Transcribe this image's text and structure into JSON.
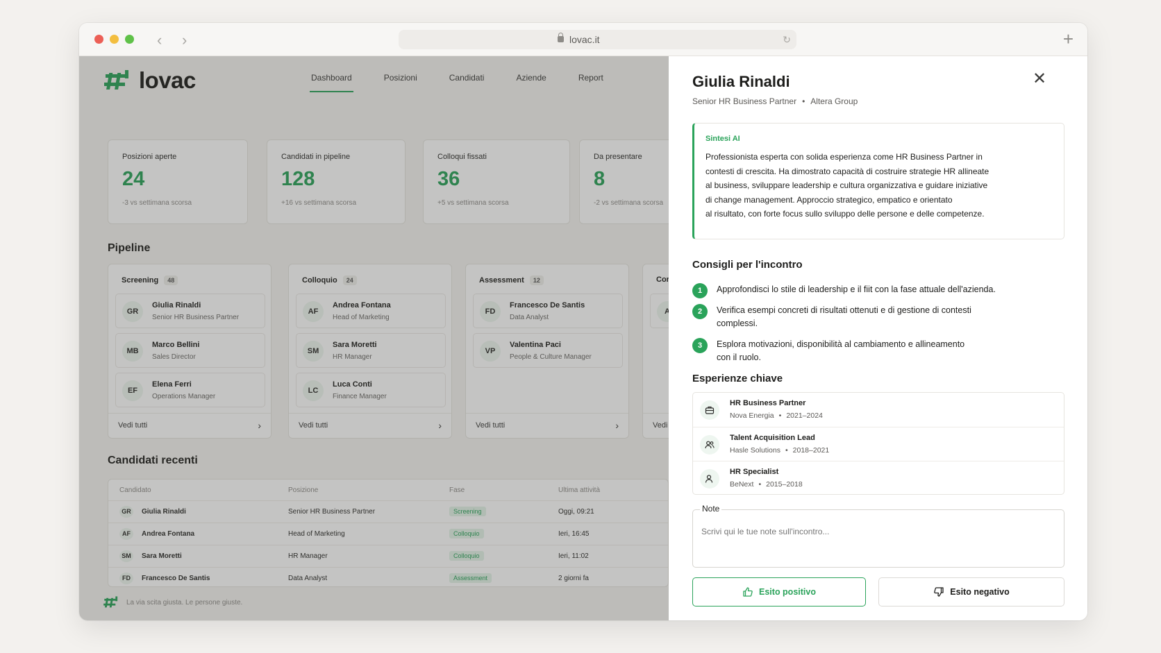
{
  "browser": {
    "url": "lovac.it"
  },
  "brand": {
    "name": "lovac",
    "tagline": "La via scita giusta. Le persone giuste.",
    "accent": "#2aa35a"
  },
  "nav": [
    "Dashboard",
    "Posizioni",
    "Candidati",
    "Aziende",
    "Report"
  ],
  "kpis": [
    {
      "label": "Posizioni aperte",
      "value": "24",
      "delta": "-3 vs settimana scorsa"
    },
    {
      "label": "Candidati in pipeline",
      "value": "128",
      "delta": "+16 vs settimana scorsa"
    },
    {
      "label": "Colloqui fissati",
      "value": "36",
      "delta": "+5 vs settimana scorsa"
    },
    {
      "label": "Da presentare",
      "value": "8",
      "delta": "-2 vs settimana scorsa"
    }
  ],
  "pipeline": {
    "title": "Pipeline",
    "see_all": "Vedi tutti",
    "columns": [
      {
        "name": "Screening",
        "count": "48",
        "cards": [
          {
            "initials": "GR",
            "name": "Giulia Rinaldi",
            "role": "Senior HR Business Partner"
          },
          {
            "initials": "MB",
            "name": "Marco Bellini",
            "role": "Sales Director"
          },
          {
            "initials": "EF",
            "name": "Elena Ferri",
            "role": "Operations Manager"
          }
        ]
      },
      {
        "name": "Colloquio",
        "count": "24",
        "cards": [
          {
            "initials": "AF",
            "name": "Andrea Fontana",
            "role": "Head of Marketing"
          },
          {
            "initials": "SM",
            "name": "Sara Moretti",
            "role": "HR Manager"
          },
          {
            "initials": "LC",
            "name": "Luca Conti",
            "role": "Finance Manager"
          }
        ]
      },
      {
        "name": "Assessment",
        "count": "12",
        "cards": [
          {
            "initials": "FD",
            "name": "Francesco De Santis",
            "role": "Data Analyst"
          },
          {
            "initials": "VP",
            "name": "Valentina Paci",
            "role": "People & Culture Manager"
          }
        ]
      },
      {
        "name": "Cor",
        "initial": "A",
        "see_all": "Vedi"
      }
    ]
  },
  "recent": {
    "title": "Candidati recenti",
    "headers": [
      "Candidato",
      "Posizione",
      "Fase",
      "Ultima attività"
    ],
    "rows": [
      {
        "initials": "GR",
        "name": "Giulia Rinaldi",
        "position": "Senior HR Business Partner",
        "phase": "Screening",
        "activity": "Oggi, 09:21"
      },
      {
        "initials": "AF",
        "name": "Andrea Fontana",
        "position": "Head of Marketing",
        "phase": "Colloquio",
        "activity": "Ieri, 16:45"
      },
      {
        "initials": "SM",
        "name": "Sara Moretti",
        "position": "HR Manager",
        "phase": "Colloquio",
        "activity": "Ieri, 11:02"
      },
      {
        "initials": "FD",
        "name": "Francesco De Santis",
        "position": "Data Analyst",
        "phase": "Assessment",
        "activity": "2 giorni fa"
      }
    ]
  },
  "panel": {
    "name": "Giulia Rinaldi",
    "role": "Senior HR Business Partner",
    "company": "Altera Group",
    "ai_title": "Sintesi AI",
    "ai_lines": [
      "Professionista esperta con solida esperienza come HR Business Partner in",
      "contesti di crescita. Ha dimostrato capacità di costruire strategie HR allineate",
      "al business, sviluppare leadership e cultura organizzativa e guidare iniziative",
      "di change management. Approccio strategico, empatico e orientato",
      "al risultato, con forte focus sullo sviluppo delle persone e delle competenze."
    ],
    "tips_title": "Consigli per l'incontro",
    "tips": [
      {
        "n": "1",
        "lines": [
          "Approfondisci lo stile di leadership e il fiit con la fase attuale dell'azienda."
        ]
      },
      {
        "n": "2",
        "lines": [
          "Verifica esempi concreti di risultati ottenuti e di gestione di contesti",
          "complessi."
        ]
      },
      {
        "n": "3",
        "lines": [
          "Esplora motivazioni, disponibilità al cambiamento e allineamento",
          "con il ruolo."
        ]
      }
    ],
    "exp_title": "Esperienze chiave",
    "experiences": [
      {
        "icon": "briefcase-icon",
        "role": "HR Business Partner",
        "company": "Nova Energia",
        "years": "2021–2024"
      },
      {
        "icon": "users-icon",
        "role": "Talent Acquisition Lead",
        "company": "Hasle Solutions",
        "years": "2018–2021"
      },
      {
        "icon": "user-icon",
        "role": "HR Specialist",
        "company": "BeNext",
        "years": "2015–2018"
      }
    ],
    "notes_label": "Note",
    "notes_placeholder": "Scrivi qui le tue note sull'incontro...",
    "positive": "Esito positivo",
    "negative": "Esito negativo"
  }
}
